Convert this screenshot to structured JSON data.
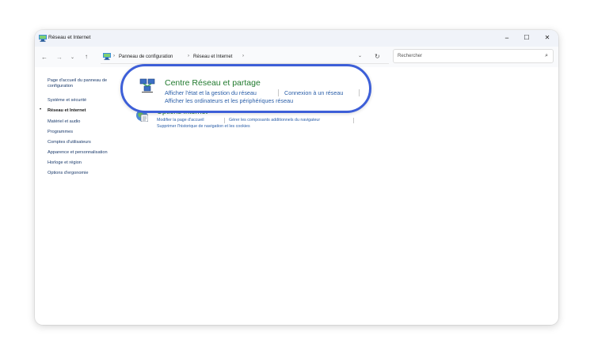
{
  "window": {
    "title": "Réseau et Internet",
    "controls": {
      "minimize": "−",
      "maximize": "☐",
      "close": "✕"
    }
  },
  "address": {
    "breadcrumbs": [
      "Panneau de configuration",
      "Réseau et Internet"
    ],
    "separator": "›",
    "search_placeholder": "Rechercher"
  },
  "sidebar": {
    "items": [
      {
        "label": "Page d'accueil du panneau de"
      },
      {
        "label": "configuration"
      },
      {
        "label": "Système et sécurité"
      },
      {
        "label": "Réseau et Internet",
        "active": true
      },
      {
        "label": "Matériel et audio"
      },
      {
        "label": "Programmes"
      },
      {
        "label": "Comptes d'utilisateurs"
      },
      {
        "label": "Apparence et personnalisation"
      },
      {
        "label": "Horloge et région"
      },
      {
        "label": "Options d'ergonomie"
      }
    ],
    "bullet": "•"
  },
  "categories": {
    "network_center": {
      "title": "Centre Réseau et partage",
      "links": [
        "Afficher l'état et la gestion du réseau",
        "Connexion à un réseau",
        "Afficher les ordinateurs et les périphériques réseau"
      ]
    },
    "internet_options": {
      "title": "Options Internet",
      "links": [
        "Modifier la page d'accueil",
        "Gérer les composants additionnels du navigateur",
        "Supprimer l'historique de navigation et les cookies"
      ]
    }
  },
  "colors": {
    "highlight_border": "#3d5fd8",
    "category_title": "#217a2e",
    "link": "#2a5ea8"
  }
}
